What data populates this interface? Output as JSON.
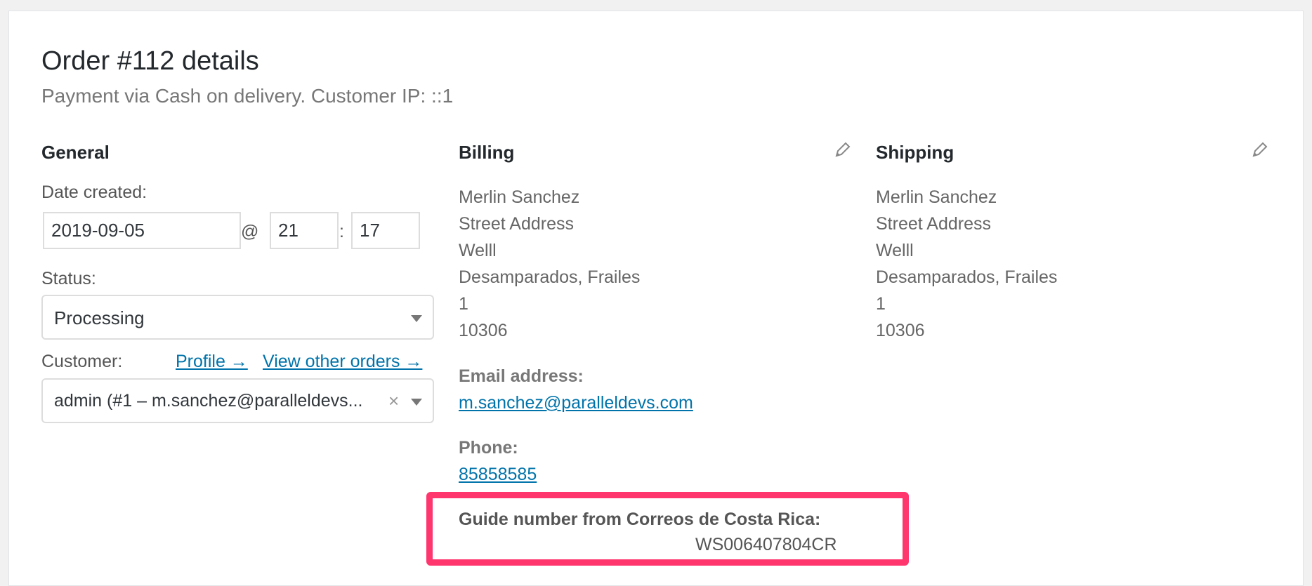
{
  "order": {
    "title": "Order #112 details",
    "subtitle": "Payment via Cash on delivery. Customer IP: ::1"
  },
  "general": {
    "heading": "General",
    "date_label": "Date created:",
    "date_value": "2019-09-05",
    "at_sign": "@",
    "hour_value": "21",
    "colon": ":",
    "minute_value": "17",
    "status_label": "Status:",
    "status_value": "Processing",
    "customer_label": "Customer:",
    "profile_link": "Profile →",
    "view_orders_link": "View other orders →",
    "customer_value": "admin (#1 – m.sanchez@paralleldevs...",
    "clear_symbol": "×"
  },
  "billing": {
    "heading": "Billing",
    "address_lines": [
      "Merlin Sanchez",
      "Street Address",
      "Welll",
      "Desamparados, Frailes",
      "1",
      "10306"
    ],
    "email_label": "Email address:",
    "email_value": "m.sanchez@paralleldevs.com",
    "phone_label": "Phone:",
    "phone_value": "85858585",
    "guide_label": "Guide number from Correos de Costa Rica:",
    "guide_value": "WS006407804CR"
  },
  "shipping": {
    "heading": "Shipping",
    "address_lines": [
      "Merlin Sanchez",
      "Street Address",
      "Welll",
      "Desamparados, Frailes",
      "1",
      "10306"
    ]
  },
  "colors": {
    "link": "#0073aa",
    "highlight": "#ff356e",
    "background": "#f1f1f1"
  },
  "icons": [
    "pencil-icon",
    "chevron-down-icon",
    "close-icon"
  ]
}
